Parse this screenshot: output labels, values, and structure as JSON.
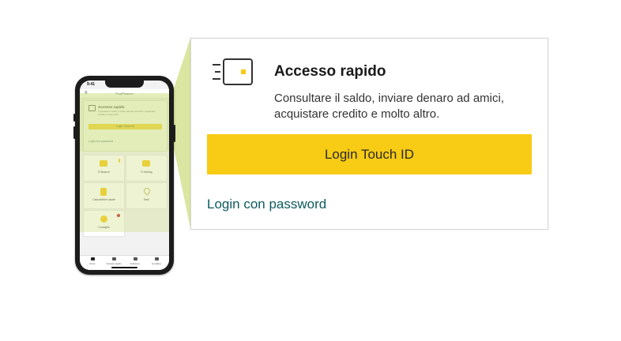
{
  "phone": {
    "status_time": "9:41",
    "app_title": "PostFinance",
    "quick_access_title": "Accesso rapido",
    "quick_access_desc": "Consultare il saldo, inviare denaro ad amici, acquistare credito e molto altro.",
    "touch_button": "Login Touch ID",
    "password_link": "Login con password",
    "tiles": [
      {
        "label": "E-finance",
        "icon": "laptop-icon",
        "color": "#f8cb14"
      },
      {
        "label": "E-trading",
        "icon": "trading-icon",
        "color": "#f8cb14"
      },
      {
        "label": "Calcolatrice valute",
        "icon": "calculator-icon",
        "color": "#f8cb14"
      },
      {
        "label": "Sedi",
        "icon": "location-pin-icon",
        "color": "#f8cb14"
      },
      {
        "label": "Consiglio",
        "icon": "info-icon",
        "color": "#f8cb14"
      }
    ],
    "tabs": [
      {
        "label": "Home"
      },
      {
        "label": "Accesso rapido"
      },
      {
        "label": "E-finance"
      },
      {
        "label": "E-trading"
      }
    ]
  },
  "card": {
    "icon": "card-swipe-icon",
    "title": "Accesso rapido",
    "description": "Consultare il saldo, inviare denaro ad amici, acquistare credito e molto altro.",
    "touch_button": "Login Touch ID",
    "password_link": "Login con password"
  },
  "colors": {
    "accent": "#f8cb14",
    "link": "#0e5a5f",
    "highlight": "#cdde82"
  }
}
